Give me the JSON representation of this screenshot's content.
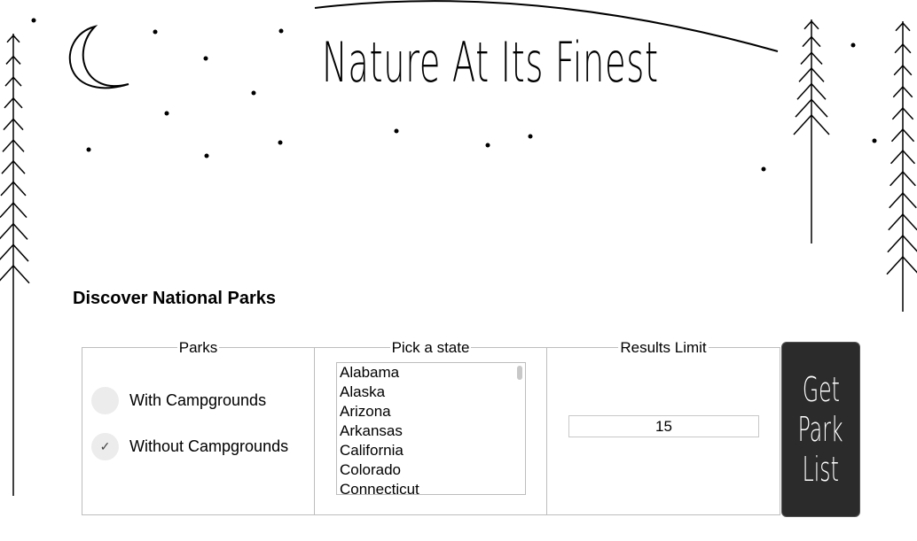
{
  "header": {
    "title": "Nature At Its Finest"
  },
  "sub_heading": "Discover National Parks",
  "parks": {
    "legend": "Parks",
    "options": [
      {
        "label": "With Campgrounds",
        "checked": false
      },
      {
        "label": "Without Campgrounds",
        "checked": true
      }
    ],
    "check_glyph": "✓"
  },
  "state": {
    "legend": "Pick a state",
    "options": [
      "Alabama",
      "Alaska",
      "Arizona",
      "Arkansas",
      "California",
      "Colorado",
      "Connecticut"
    ]
  },
  "limit": {
    "legend": "Results Limit",
    "value": "15"
  },
  "button": {
    "words": [
      "Get",
      "Park",
      "List"
    ]
  },
  "colors": {
    "button_bg": "#2b2b2b",
    "radio_bg": "#ececec",
    "border": "#bdbdbd"
  },
  "decor_icons": [
    "moon-icon",
    "star-icon",
    "pine-tree-icon"
  ]
}
